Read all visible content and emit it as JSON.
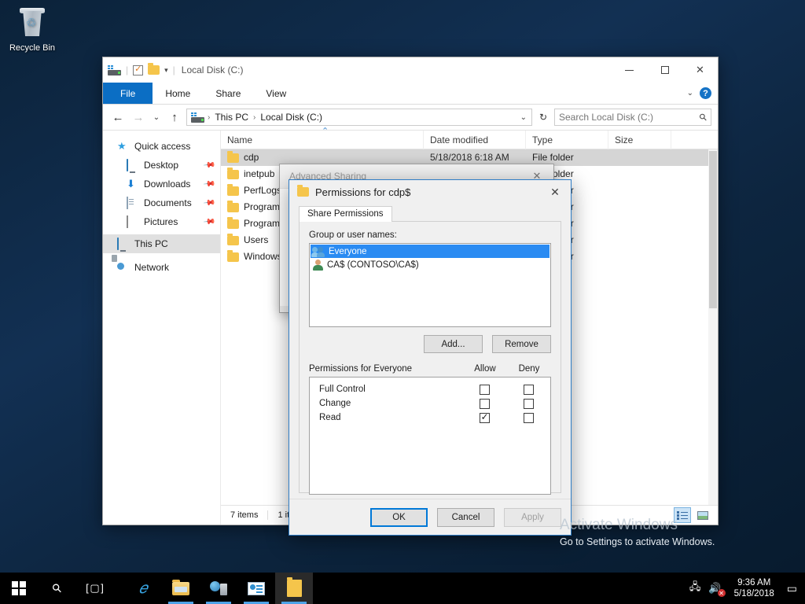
{
  "desktop": {
    "recycle_bin_label": "Recycle Bin"
  },
  "explorer": {
    "title": "Local Disk (C:)",
    "quick_access_icons": [
      "drive-icon",
      "properties-icon",
      "new-folder-icon",
      "customize-caret-icon"
    ],
    "window_buttons": {
      "minimize": "—",
      "maximize": "☐",
      "close": "✕"
    },
    "ribbon": {
      "tabs": [
        "File",
        "Home",
        "Share",
        "View"
      ],
      "collapse_label": "⌄",
      "help_label": "?"
    },
    "address": {
      "back": "←",
      "forward": "→",
      "recent": "⌄",
      "up": "↑",
      "crumbs": [
        "This PC",
        "Local Disk (C:)"
      ],
      "separator": "›",
      "dropdown": "⌄",
      "refresh": "↻"
    },
    "search": {
      "placeholder": "Search Local Disk (C:)",
      "value": "",
      "icon": "search-icon"
    },
    "navpane": [
      {
        "label": "Quick access",
        "icon": "star-icon",
        "level": 0,
        "pinned": false,
        "selected": false
      },
      {
        "label": "Desktop",
        "icon": "monitor-icon",
        "level": 1,
        "pinned": true,
        "selected": false
      },
      {
        "label": "Downloads",
        "icon": "download-icon",
        "level": 1,
        "pinned": true,
        "selected": false
      },
      {
        "label": "Documents",
        "icon": "document-icon",
        "level": 1,
        "pinned": true,
        "selected": false
      },
      {
        "label": "Pictures",
        "icon": "picture-icon",
        "level": 1,
        "pinned": true,
        "selected": false
      },
      {
        "label": "This PC",
        "icon": "computer-icon",
        "level": 0,
        "pinned": false,
        "selected": true
      },
      {
        "label": "Network",
        "icon": "network-icon",
        "level": 0,
        "pinned": false,
        "selected": false
      }
    ],
    "columns": [
      "Name",
      "Date modified",
      "Type",
      "Size"
    ],
    "files": [
      {
        "name": "cdp",
        "date": "5/18/2018 6:18 AM",
        "type": "File folder",
        "size": "",
        "selected": true
      },
      {
        "name": "inetpub",
        "date": "",
        "type": "File folder",
        "size": "",
        "selected": false
      },
      {
        "name": "PerfLogs",
        "date": "",
        "type": "File folder",
        "size": "",
        "selected": false
      },
      {
        "name": "Program Files",
        "date": "",
        "type": "File folder",
        "size": "",
        "selected": false
      },
      {
        "name": "Program Files (x86)",
        "date": "",
        "type": "File folder",
        "size": "",
        "selected": false
      },
      {
        "name": "Users",
        "date": "",
        "type": "File folder",
        "size": "",
        "selected": false
      },
      {
        "name": "Windows",
        "date": "",
        "type": "File folder",
        "size": "",
        "selected": false
      }
    ],
    "status": {
      "item_count": "7 items",
      "selection": "1 item selected",
      "view_details": "details-view-icon",
      "view_tiles": "large-icons-view-icon"
    }
  },
  "advanced_sharing": {
    "title": "Advanced Sharing",
    "close": "✕"
  },
  "permissions_dialog": {
    "title": "Permissions for cdp$",
    "close": "✕",
    "tabs": [
      "Share Permissions"
    ],
    "group_label": "Group or user names:",
    "groups": [
      {
        "name": "Everyone",
        "icon": "users-group-icon",
        "selected": true
      },
      {
        "name": "CA$ (CONTOSO\\CA$)",
        "icon": "user-icon",
        "selected": false
      }
    ],
    "add_button": "Add...",
    "remove_button": "Remove",
    "permissions_label": "Permissions for Everyone",
    "permission_columns": [
      "Allow",
      "Deny"
    ],
    "permissions": [
      {
        "name": "Full Control",
        "allow": false,
        "deny": false
      },
      {
        "name": "Change",
        "allow": false,
        "deny": false
      },
      {
        "name": "Read",
        "allow": true,
        "deny": false
      }
    ],
    "footer": {
      "ok": "OK",
      "cancel": "Cancel",
      "apply": "Apply",
      "apply_disabled": true
    }
  },
  "watermark": {
    "title": "Activate Windows",
    "subtitle": "Go to Settings to activate Windows."
  },
  "taskbar": {
    "start": "start-icon",
    "search": "search-icon",
    "task_view": "task-view-icon",
    "apps": [
      {
        "name": "internet-explorer",
        "running": false
      },
      {
        "name": "file-explorer",
        "running": true
      },
      {
        "name": "server-manager-network",
        "running": true
      },
      {
        "name": "server-manager",
        "running": true
      },
      {
        "name": "file-explorer-window",
        "running": true,
        "active": true
      }
    ],
    "tray": {
      "network": "network-icon",
      "volume": "volume-muted-icon",
      "time": "9:36 AM",
      "date": "5/18/2018",
      "action_center": "action-center-icon"
    }
  },
  "colors": {
    "accent": "#0078d7",
    "selection": "#2a8bf2",
    "taskbar": "#000000",
    "ribbon_file": "#0b6ec4"
  }
}
